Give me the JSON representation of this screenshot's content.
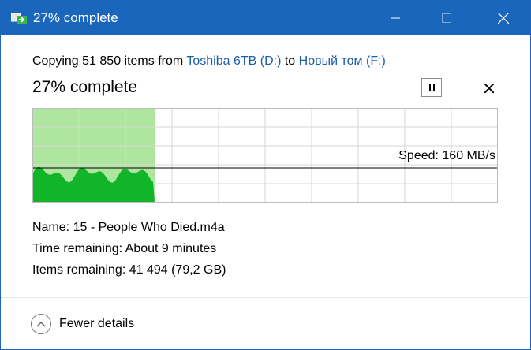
{
  "window": {
    "title": "27% complete"
  },
  "copy": {
    "prefix": "Copying 51 850 items from",
    "source": "Toshiba 6TB (D:)",
    "to_word": "to",
    "destination": "Новый том (F:)"
  },
  "progress": {
    "label": "27% complete",
    "percent": 27,
    "speed_label": "Speed: 160 MB/s"
  },
  "details": {
    "name_label": "Name:",
    "name_value": "15 - People Who Died.m4a",
    "time_label": "Time remaining:",
    "time_value": "About 9 minutes",
    "items_label": "Items remaining:",
    "items_value": "41 494 (79,2 GB)"
  },
  "footer": {
    "fewer_details": "Fewer details"
  },
  "colors": {
    "titlebar": "#1b66bd",
    "progress_fill": "#aee6a0",
    "speed_fill": "#12b52a",
    "link": "#1a5ea8"
  }
}
